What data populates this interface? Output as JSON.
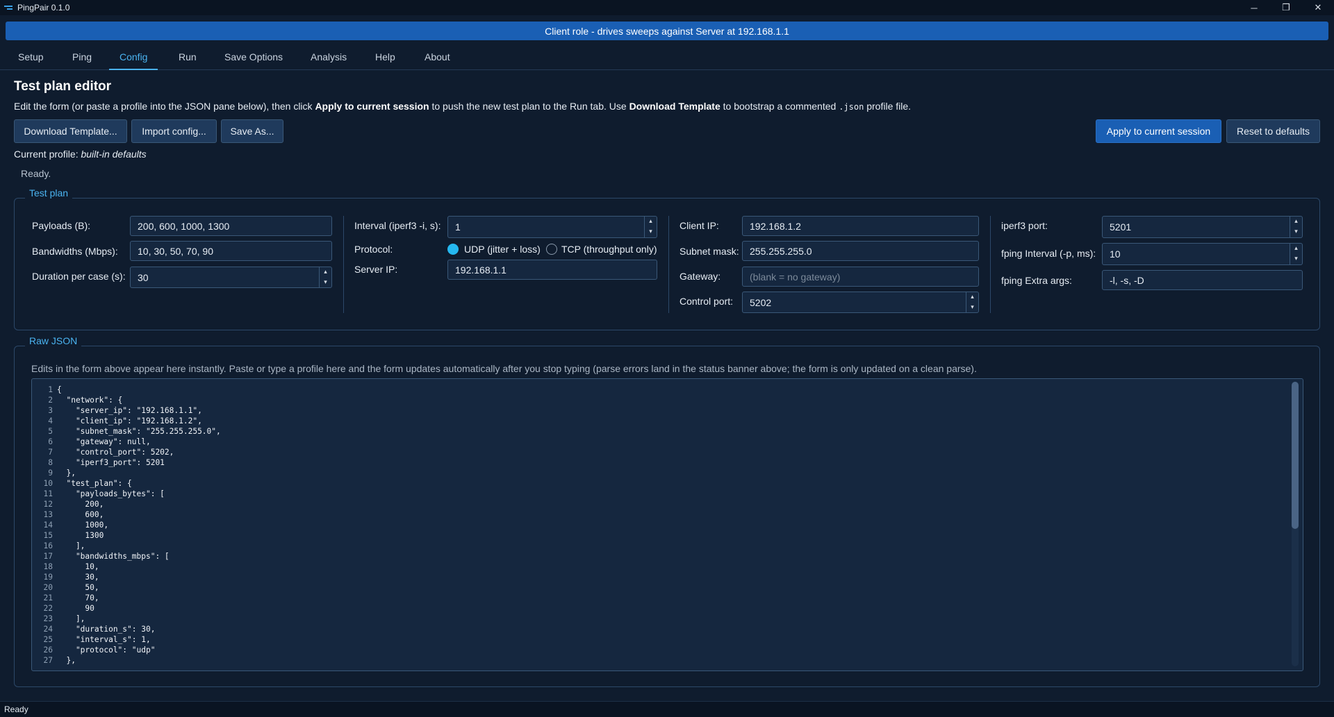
{
  "window": {
    "title": "PingPair 0.1.0",
    "controls": [
      "─",
      "❐",
      "✕"
    ]
  },
  "banner": "Client role - drives sweeps against Server at 192.168.1.1",
  "tabs": [
    {
      "label": "Setup"
    },
    {
      "label": "Ping"
    },
    {
      "label": "Config",
      "active": true
    },
    {
      "label": "Run"
    },
    {
      "label": "Save Options"
    },
    {
      "label": "Analysis"
    },
    {
      "label": "Help"
    },
    {
      "label": "About"
    }
  ],
  "editor": {
    "title": "Test plan editor",
    "desc": {
      "p1": "Edit the form (or paste a profile into the JSON pane below), then click ",
      "b1": "Apply to current session",
      "p2": " to push the new test plan to the Run tab. Use ",
      "b2": "Download Template",
      "p3": " to bootstrap a commented ",
      "code": ".json",
      "p4": " profile file."
    },
    "buttons": {
      "download": "Download Template...",
      "import": "Import config...",
      "save_as": "Save As...",
      "apply": "Apply to current session",
      "reset": "Reset to defaults"
    },
    "profile_label": "Current profile: ",
    "profile_name": "built-in defaults",
    "status": "Ready."
  },
  "test_plan": {
    "group_title": "Test plan",
    "payloads_label": "Payloads (B):",
    "payloads_value": "200, 600, 1000, 1300",
    "bandwidths_label": "Bandwidths (Mbps):",
    "bandwidths_value": "10, 30, 50, 70, 90",
    "duration_label": "Duration per case (s):",
    "duration_value": "30",
    "interval_label": "Interval (iperf3 -i, s):",
    "interval_value": "1",
    "protocol_label": "Protocol:",
    "udp_label": "UDP (jitter + loss)",
    "tcp_label": "TCP (throughput only)",
    "protocol_selected": "UDP",
    "server_ip_label": "Server IP:",
    "server_ip_value": "192.168.1.1",
    "client_ip_label": "Client IP:",
    "client_ip_value": "192.168.1.2",
    "subnet_label": "Subnet mask:",
    "subnet_value": "255.255.255.0",
    "gateway_label": "Gateway:",
    "gateway_placeholder": "(blank = no gateway)",
    "control_port_label": "Control port:",
    "control_port_value": "5202",
    "iperf3_port_label": "iperf3 port:",
    "iperf3_port_value": "5201",
    "fping_interval_label": "fping Interval (-p, ms):",
    "fping_interval_value": "10",
    "fping_extra_label": "fping Extra args:",
    "fping_extra_value": "-l, -s, -D"
  },
  "raw_json": {
    "group_title": "Raw JSON",
    "note": "Edits in the form above appear here instantly.  Paste or type a profile here and the form updates automatically after you stop typing (parse errors land in the status banner above; the form is only updated on a clean parse).",
    "lines": [
      "{",
      "  \"network\": {",
      "    \"server_ip\": \"192.168.1.1\",",
      "    \"client_ip\": \"192.168.1.2\",",
      "    \"subnet_mask\": \"255.255.255.0\",",
      "    \"gateway\": null,",
      "    \"control_port\": 5202,",
      "    \"iperf3_port\": 5201",
      "  },",
      "  \"test_plan\": {",
      "    \"payloads_bytes\": [",
      "      200,",
      "      600,",
      "      1000,",
      "      1300",
      "    ],",
      "    \"bandwidths_mbps\": [",
      "      10,",
      "      30,",
      "      50,",
      "      70,",
      "      90",
      "    ],",
      "    \"duration_s\": 30,",
      "    \"interval_s\": 1,",
      "    \"protocol\": \"udp\"",
      "  },"
    ]
  },
  "statusbar": "Ready",
  "colors": {
    "accent": "#4ab3f0",
    "banner": "#1a5fb4",
    "background": "#0f1c2e"
  }
}
